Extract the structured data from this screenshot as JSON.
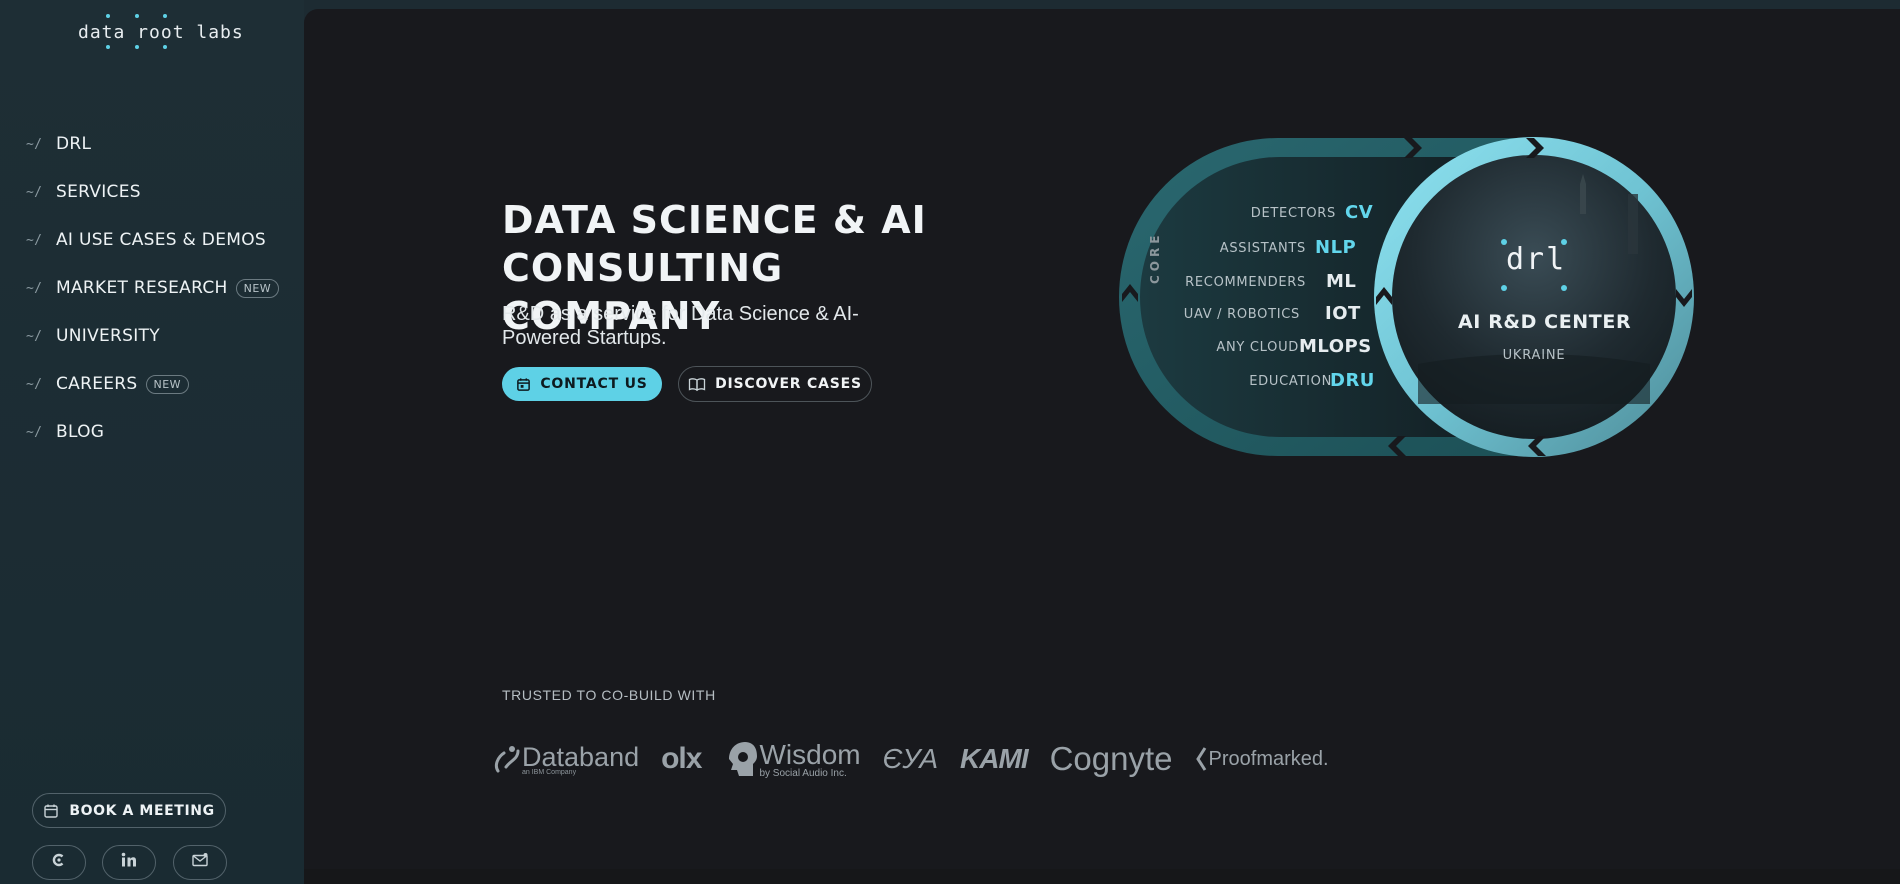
{
  "sidebar": {
    "logo_text": "data root labs",
    "nav": [
      {
        "label": "DRL",
        "badge": ""
      },
      {
        "label": "SERVICES",
        "badge": ""
      },
      {
        "label": "AI USE CASES & DEMOS",
        "badge": ""
      },
      {
        "label": "MARKET RESEARCH",
        "badge": "NEW"
      },
      {
        "label": "UNIVERSITY",
        "badge": ""
      },
      {
        "label": "CAREERS",
        "badge": "NEW"
      },
      {
        "label": "BLOG",
        "badge": ""
      }
    ],
    "nav_arrow": "~/",
    "book_meeting": "BOOK A MEETING",
    "social": [
      "clutch-icon",
      "linkedin-icon",
      "email-icon"
    ]
  },
  "hero": {
    "title_line1": "DATA SCIENCE & AI",
    "title_line2": "CONSULTING COMPANY",
    "subtitle": "R&D as a service for Data Science & AI-Powered Startups.",
    "contact_button": "CONTACT US",
    "discover_button": "DISCOVER CASES"
  },
  "diagram": {
    "core_label": "CORE",
    "rows": [
      {
        "label": "DETECTORS",
        "code": "CV",
        "accent": true
      },
      {
        "label": "ASSISTANTS",
        "code": "NLP",
        "accent": true
      },
      {
        "label": "RECOMMENDERS",
        "code": "ML",
        "accent": false
      },
      {
        "label": "UAV / ROBOTICS",
        "code": "IOT",
        "accent": false
      },
      {
        "label": "ANY CLOUD",
        "code": "MLOPS",
        "accent": false
      },
      {
        "label": "EDUCATION",
        "code": "DRU",
        "accent": true
      }
    ],
    "center_logo": "drl",
    "center_title": "AI R&D CENTER",
    "center_subtitle": "UKRAINE"
  },
  "trusted": {
    "heading": "TRUSTED TO CO-BUILD WITH",
    "logos": [
      {
        "name": "Databand",
        "sub": "an IBM Company"
      },
      {
        "name": "olx",
        "sub": ""
      },
      {
        "name": "Wisdom",
        "sub": "by Social Audio Inc."
      },
      {
        "name": "ЄУА",
        "sub": ""
      },
      {
        "name": "KAMI",
        "sub": ""
      },
      {
        "name": "Cognyte",
        "sub": ""
      },
      {
        "name": "Proofmarked.",
        "sub": ""
      }
    ]
  },
  "colors": {
    "accent": "#5ed1e6",
    "sidebar_bg": "#1e2e35",
    "main_bg": "#18191d",
    "ring_dark": "#1f5f66",
    "ring_light": "#7cd3e3"
  }
}
